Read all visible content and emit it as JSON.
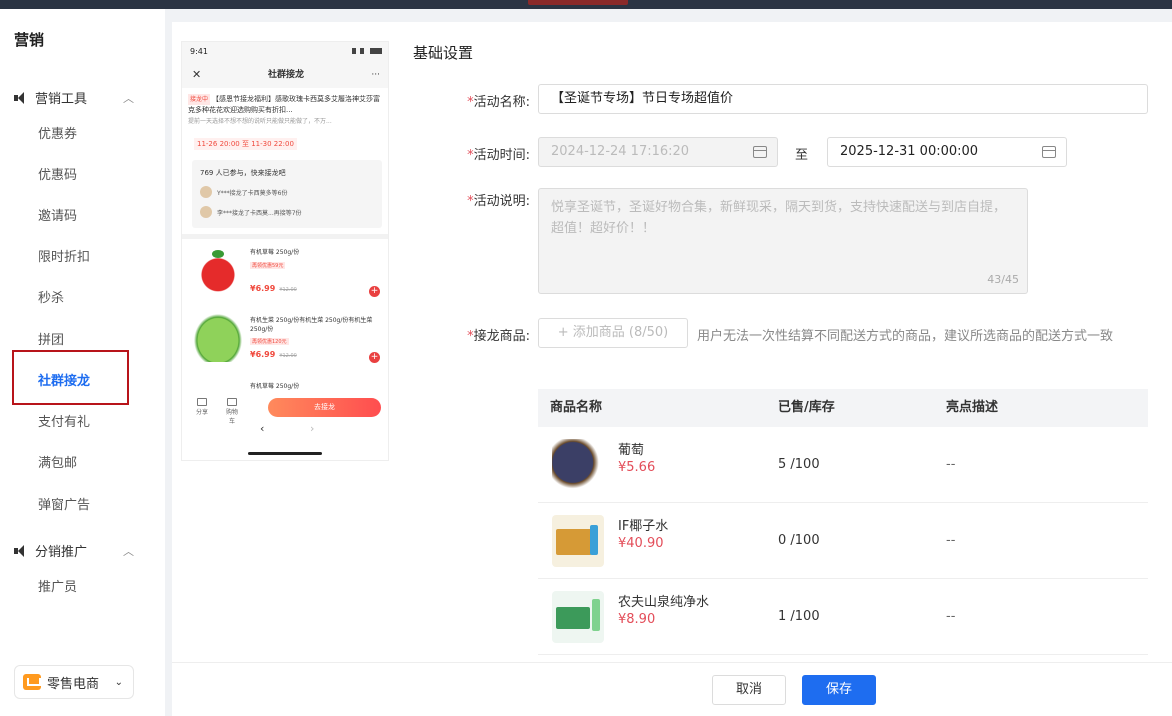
{
  "sidebar": {
    "title": "营销",
    "group_tools": "营销工具",
    "items": [
      "优惠券",
      "优惠码",
      "邀请码",
      "限时折扣",
      "秒杀",
      "拼团",
      "社群接龙",
      "支付有礼",
      "满包邮",
      "弹窗广告"
    ],
    "group_distribution": "分销推广",
    "dist_items": [
      "推广员"
    ],
    "store_switch": "零售电商",
    "active_item": "社群接龙"
  },
  "phone": {
    "time": "9:41",
    "nav_title": "社群接龙",
    "notice_tag": "接龙中",
    "notice_text": "【感恩节接龙福利】感歌玫瑰卡西莫多艾履洛神艾莎富克多种花花欢迎选购购买有折扣...",
    "notice_sub": "提前一天选择不想不想的说听只能做只能做了，不万...",
    "time_range": "11-26 20:00 至 11-30 22:00",
    "joined_header": "769 人已参与，快来接龙吧",
    "joined_rows": [
      "Y***接龙了卡西莫多等6份",
      "李***接龙了卡西莫...再接等7份"
    ],
    "products": [
      {
        "name": "有机草莓 250g/份",
        "tag": "再领优惠59元",
        "price": "¥6.99",
        "old": "¥12.00"
      },
      {
        "name": "有机生菜 250g/份有机生菜 250g/份有机生菜 250g/份",
        "tag": "再领优惠120元",
        "price": "¥6.99",
        "old": "¥12.00"
      },
      {
        "name": "有机草莓 250g/份",
        "tag": "",
        "price": "",
        "old": ""
      }
    ],
    "bottom_share": "分享",
    "bottom_cart": "购物车",
    "cta": "去接龙",
    "pager_prev": "‹",
    "pager_next": "›"
  },
  "form": {
    "section_title": "基础设置",
    "name_label": "活动名称:",
    "name_value": "【圣诞节专场】节日专场超值价",
    "time_label": "活动时间:",
    "start_time": "2024-12-24 17:16:20",
    "to": "至",
    "end_time": "2025-12-31 00:00:00",
    "desc_label": "活动说明:",
    "desc_value": "悦享圣诞节，圣诞好物合集，新鲜现采，隔天到货，支持快速配送与到店自提，超值！超好价！！",
    "desc_count": "43/45",
    "goods_label": "接龙商品:",
    "add_goods": "+ 添加商品 (8/50)",
    "hint": "用户无法一次性结算不同配送方式的商品，建议所选商品的配送方式一致"
  },
  "table": {
    "headers": [
      "商品名称",
      "已售/库存",
      "亮点描述"
    ],
    "rows": [
      {
        "name": "葡萄",
        "price": "¥5.66",
        "sold": "5 /100",
        "desc": "--"
      },
      {
        "name": "IF椰子水",
        "price": "¥40.90",
        "sold": "0 /100",
        "desc": "--"
      },
      {
        "name": "农夫山泉纯净水",
        "price": "¥8.90",
        "sold": "1 /100",
        "desc": "--"
      }
    ]
  },
  "footer": {
    "cancel": "取消",
    "save": "保存"
  }
}
